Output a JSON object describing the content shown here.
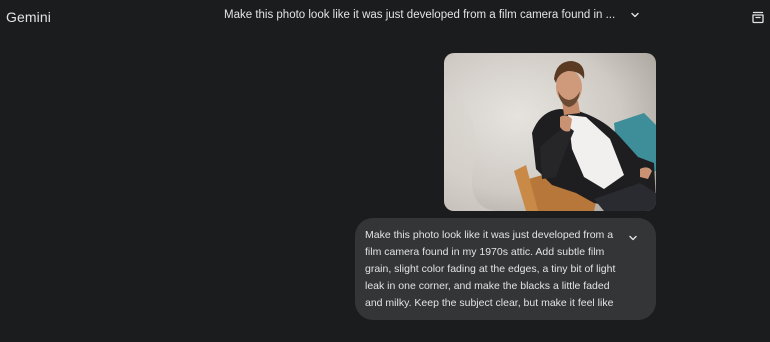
{
  "header": {
    "app_name": "Gemini",
    "conversation_title": "Make this photo look like it was just developed from a film camera found in ...",
    "title_dropdown_icon": "chevron-down-icon",
    "action_icon": "trash-icon"
  },
  "message": {
    "image_alt": "Uploaded photo of a man sitting in a chair",
    "prompt_text": "Make this photo look like it was just developed from a film camera found in my 1970s attic. Add subtle film grain, slight color fading at the edges, a tiny bit of light leak in one corner, and make the blacks a little faded and milky. Keep the subject clear, but make it feel like a…",
    "expand_icon": "chevron-down-icon"
  },
  "colors": {
    "background": "#1b1c1d",
    "bubble": "#333537",
    "text": "#e3e3e3"
  }
}
